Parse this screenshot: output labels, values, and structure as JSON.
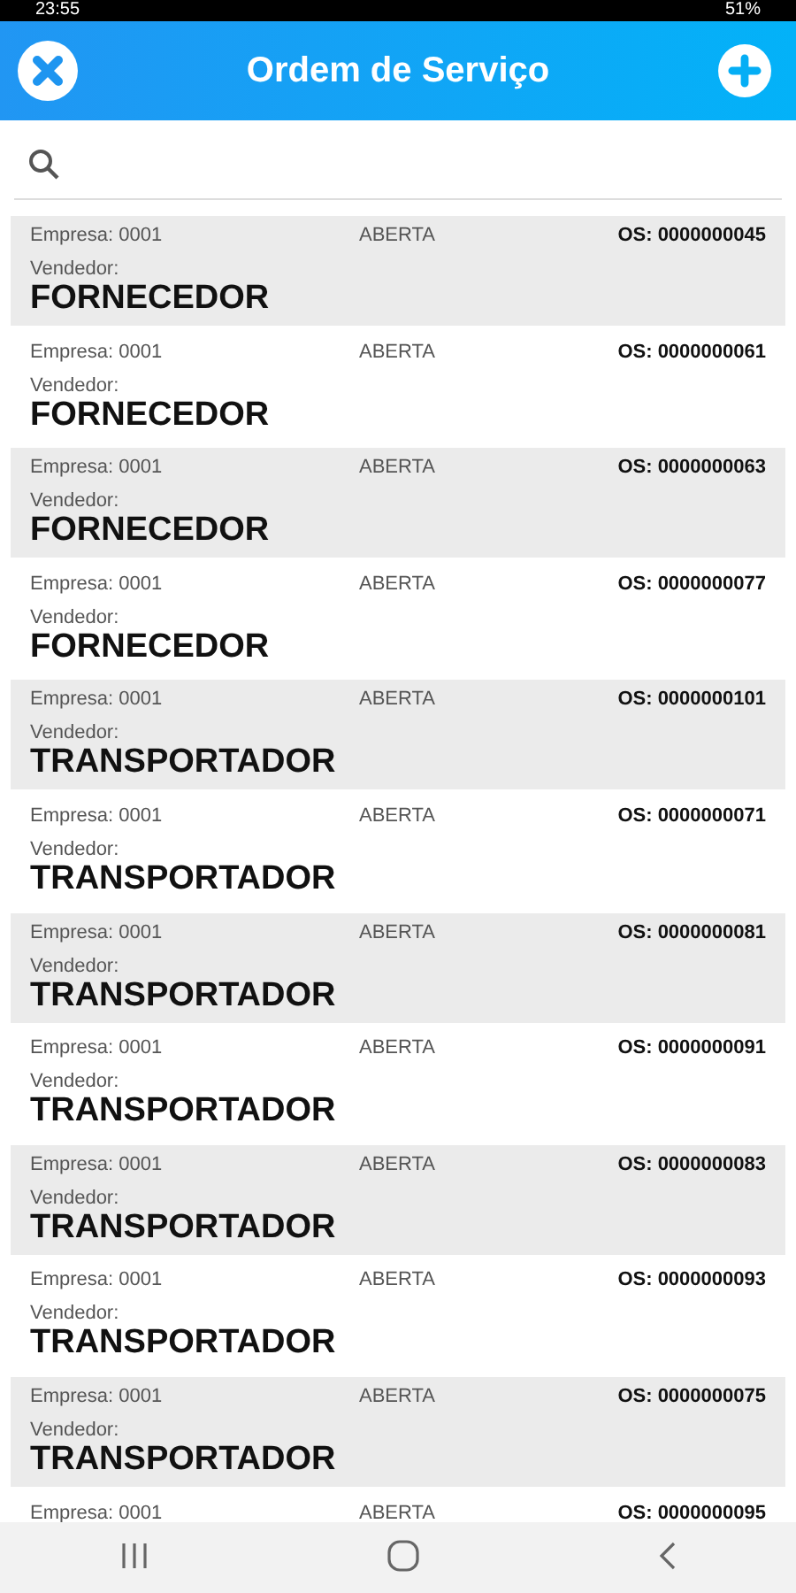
{
  "status_bar": {
    "time": "23:55",
    "battery": "51%"
  },
  "header": {
    "title": "Ordem de Serviço"
  },
  "orders": [
    {
      "empresa": "Empresa: 0001",
      "status": "ABERTA",
      "os": "OS: 0000000045",
      "vendedor_label": "Vendedor:",
      "vendedor": "FORNECEDOR"
    },
    {
      "empresa": "Empresa: 0001",
      "status": "ABERTA",
      "os": "OS: 0000000061",
      "vendedor_label": "Vendedor:",
      "vendedor": "FORNECEDOR"
    },
    {
      "empresa": "Empresa: 0001",
      "status": "ABERTA",
      "os": "OS: 0000000063",
      "vendedor_label": "Vendedor:",
      "vendedor": "FORNECEDOR"
    },
    {
      "empresa": "Empresa: 0001",
      "status": "ABERTA",
      "os": "OS: 0000000077",
      "vendedor_label": "Vendedor:",
      "vendedor": "FORNECEDOR"
    },
    {
      "empresa": "Empresa: 0001",
      "status": "ABERTA",
      "os": "OS: 0000000101",
      "vendedor_label": "Vendedor:",
      "vendedor": "TRANSPORTADOR"
    },
    {
      "empresa": "Empresa: 0001",
      "status": "ABERTA",
      "os": "OS: 0000000071",
      "vendedor_label": "Vendedor:",
      "vendedor": "TRANSPORTADOR"
    },
    {
      "empresa": "Empresa: 0001",
      "status": "ABERTA",
      "os": "OS: 0000000081",
      "vendedor_label": "Vendedor:",
      "vendedor": "TRANSPORTADOR"
    },
    {
      "empresa": "Empresa: 0001",
      "status": "ABERTA",
      "os": "OS: 0000000091",
      "vendedor_label": "Vendedor:",
      "vendedor": "TRANSPORTADOR"
    },
    {
      "empresa": "Empresa: 0001",
      "status": "ABERTA",
      "os": "OS: 0000000083",
      "vendedor_label": "Vendedor:",
      "vendedor": "TRANSPORTADOR"
    },
    {
      "empresa": "Empresa: 0001",
      "status": "ABERTA",
      "os": "OS: 0000000093",
      "vendedor_label": "Vendedor:",
      "vendedor": "TRANSPORTADOR"
    },
    {
      "empresa": "Empresa: 0001",
      "status": "ABERTA",
      "os": "OS: 0000000075",
      "vendedor_label": "Vendedor:",
      "vendedor": "TRANSPORTADOR"
    },
    {
      "empresa": "Empresa: 0001",
      "status": "ABERTA",
      "os": "OS: 0000000095"
    }
  ]
}
